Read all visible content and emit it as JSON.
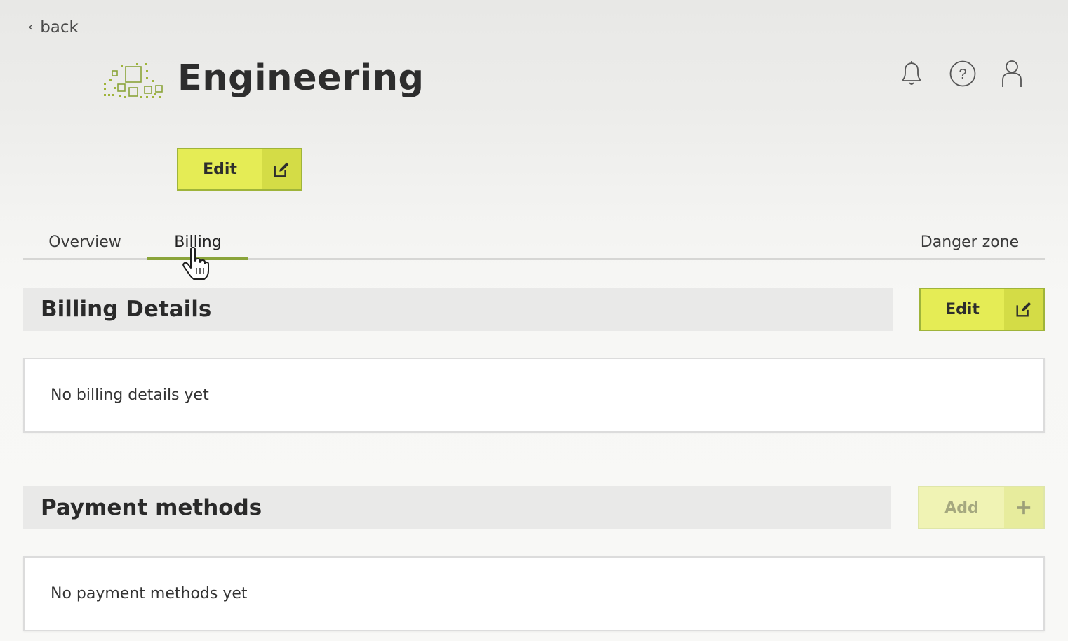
{
  "nav": {
    "back_label": "back"
  },
  "header": {
    "title": "Engineering",
    "logo_icon": "organization-logo-icon",
    "icons": [
      "bell-icon",
      "help-icon",
      "user-icon"
    ],
    "edit_label": "Edit"
  },
  "tabs": [
    {
      "label": "Overview",
      "active": false
    },
    {
      "label": "Billing",
      "active": true
    },
    {
      "label": "Danger zone",
      "active": false
    }
  ],
  "billing_details": {
    "title": "Billing Details",
    "edit_label": "Edit",
    "empty_text": "No billing details yet"
  },
  "payment_methods": {
    "title": "Payment methods",
    "add_label": "Add",
    "empty_text": "No payment methods yet"
  },
  "colors": {
    "accent": "#e5ec55",
    "accent_border": "#9fb43a",
    "tab_active": "#8aa43a"
  }
}
